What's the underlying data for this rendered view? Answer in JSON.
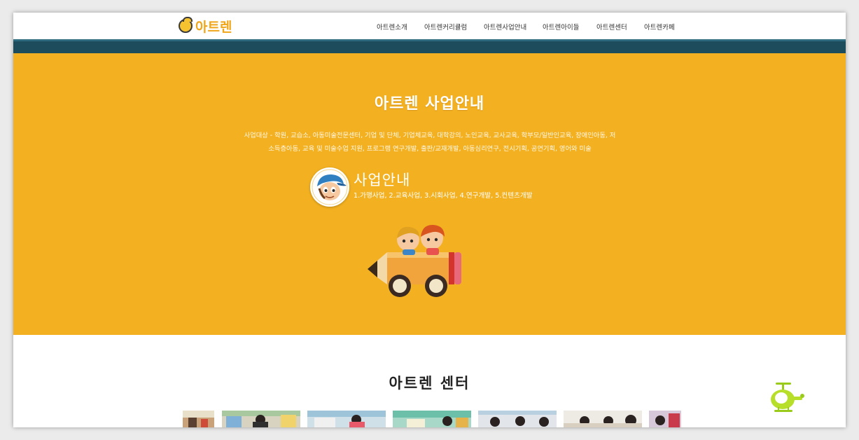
{
  "header": {
    "logo_text": "아트렌",
    "nav": [
      "아트렌소개",
      "아트렌커리큘럼",
      "아트렌사업안내",
      "아트렌아이들",
      "아트렌센터",
      "아트렌카페"
    ]
  },
  "hero": {
    "title": "아트렌 사업안내",
    "desc_line1": "사업대상 - 학원, 교습소, 아동미술전문센터, 기업 및 단체, 기업체교육, 대학강의, 노인교육, 교사교육, 학부모/일반인교육, 장애인아동, 저",
    "desc_line2": "소득층아동, 교육 및 미술수업 지원, 프로그램 연구개발, 출판/교재개발, 아동심리연구, 전시기획, 공연기획, 영어와 미술",
    "business_title": "사업안내",
    "business_list": "1.가맹사업, 2.교육사업, 3.시회사업, 4.연구개발, 5.컨텐츠개발"
  },
  "center": {
    "title": "아트렌 센터"
  },
  "colors": {
    "accent_orange": "#f3b121",
    "header_band": "#1d4c5d",
    "logo_orange": "#f0a61a"
  },
  "icons": [
    "logo-mark-icon",
    "boy-face-icon",
    "pencil-car-icon",
    "helicopter-icon"
  ]
}
